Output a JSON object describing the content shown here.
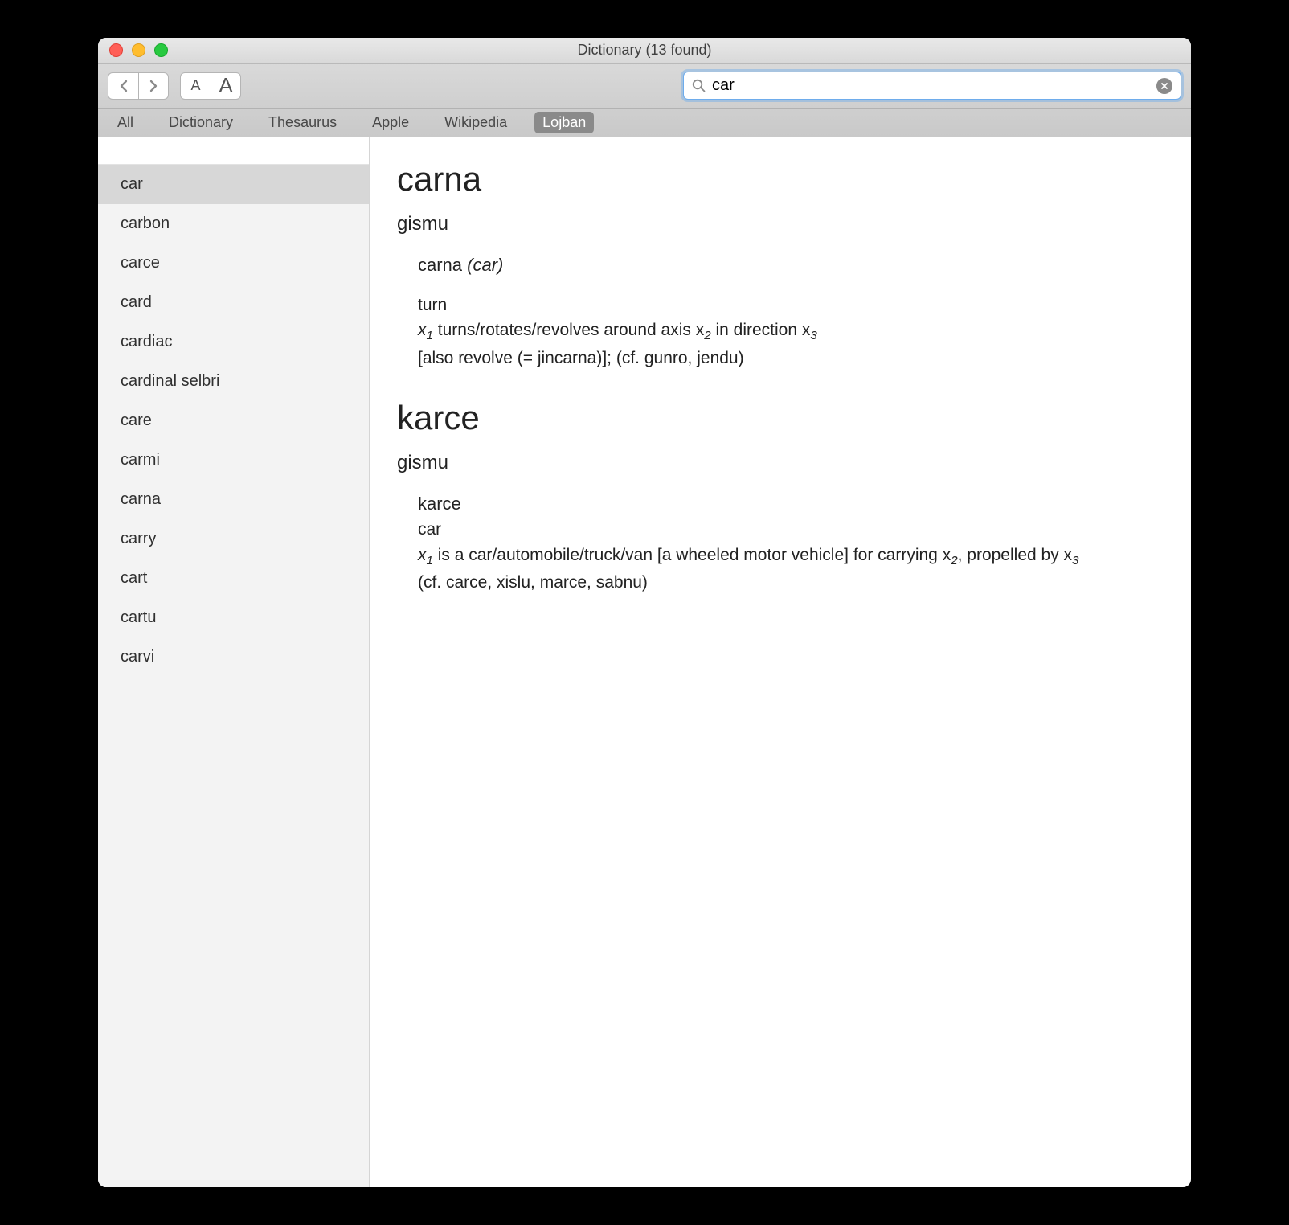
{
  "window_title": "Dictionary (13 found)",
  "search": {
    "value": "car",
    "placeholder": ""
  },
  "sources": [
    {
      "label": "All",
      "selected": false
    },
    {
      "label": "Dictionary",
      "selected": false
    },
    {
      "label": "Thesaurus",
      "selected": false
    },
    {
      "label": "Apple",
      "selected": false
    },
    {
      "label": "Wikipedia",
      "selected": false
    },
    {
      "label": "Lojban",
      "selected": true
    }
  ],
  "results": [
    {
      "label": "car",
      "selected": true
    },
    {
      "label": "carbon",
      "selected": false
    },
    {
      "label": "carce",
      "selected": false
    },
    {
      "label": "card",
      "selected": false
    },
    {
      "label": "cardiac",
      "selected": false
    },
    {
      "label": "cardinal selbri",
      "selected": false
    },
    {
      "label": "care",
      "selected": false
    },
    {
      "label": "carmi",
      "selected": false
    },
    {
      "label": "carna",
      "selected": false
    },
    {
      "label": "carry",
      "selected": false
    },
    {
      "label": "cart",
      "selected": false
    },
    {
      "label": "cartu",
      "selected": false
    },
    {
      "label": "carvi",
      "selected": false
    }
  ],
  "entry1": {
    "title": "carna",
    "pos": "gismu",
    "headword": "carna ",
    "rafsi": "(car)",
    "gloss": "turn",
    "def_pre": "x",
    "def_mid1": " turns/rotates/revolves around axis x",
    "def_mid2": " in direction x",
    "note": "[also revolve (= jincarna)]; (cf. gunro, jendu)"
  },
  "entry2": {
    "title": "karce",
    "pos": "gismu",
    "headword": "karce",
    "gloss": "car",
    "def_mid1": " is a car/automobile/truck/van [a wheeled motor vehicle] for carrying x",
    "def_mid2": ", propelled by x",
    "note": "(cf. carce, xislu, marce, sabnu)"
  }
}
